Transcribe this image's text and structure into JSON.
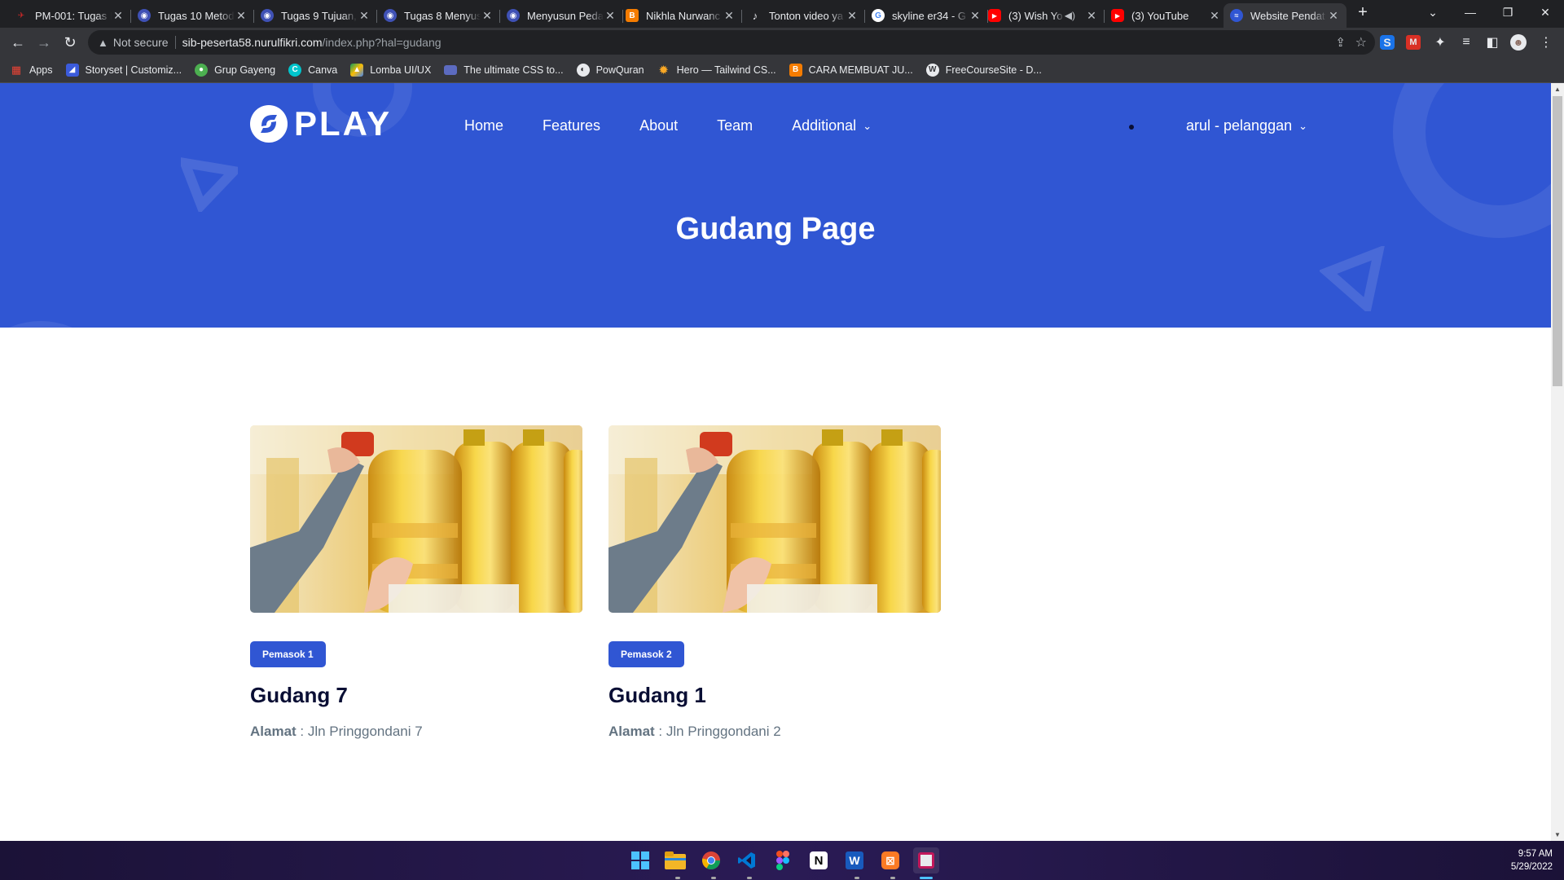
{
  "browser": {
    "tabs": [
      {
        "title": "PM-001: Tugas I",
        "favicon": "bird-icon",
        "color": "#c62828"
      },
      {
        "title": "Tugas 10 Metode",
        "favicon": "globe-icon",
        "color": "#3f51b5"
      },
      {
        "title": "Tugas 9 Tujuan,",
        "favicon": "globe-icon",
        "color": "#3f51b5"
      },
      {
        "title": "Tugas 8 Menyusu",
        "favicon": "globe-icon",
        "color": "#3f51b5"
      },
      {
        "title": "Menyusun Peda",
        "favicon": "globe-icon",
        "color": "#3f51b5"
      },
      {
        "title": "Nikhla Nurwanc",
        "favicon": "blogger-icon",
        "color": "#f57c00"
      },
      {
        "title": "Tonton video ya",
        "favicon": "tiktok-icon",
        "color": "#202124"
      },
      {
        "title": "skyline er34 - G",
        "favicon": "google-icon",
        "color": "#ffffff"
      },
      {
        "title": "(3) Wish Yo",
        "favicon": "youtube-icon",
        "color": "#ff0000"
      },
      {
        "title": "(3) YouTube",
        "favicon": "youtube-icon",
        "color": "#ff0000"
      },
      {
        "title": "Website Pendat",
        "favicon": "play-logo-icon",
        "color": "#3056d3"
      }
    ],
    "address": {
      "security": "Not secure",
      "host": "sib-peserta58.nurulfikri.com",
      "path": "/index.php?hal=gudang"
    },
    "bookmarks": [
      {
        "label": "Apps",
        "icon": "apps-grid-icon",
        "color": "#ea4335"
      },
      {
        "label": "Storyset | Customiz...",
        "icon": "storyset-icon",
        "color": "#3b5bdb"
      },
      {
        "label": "Grup Gayeng",
        "icon": "group-icon",
        "color": "#4caf50"
      },
      {
        "label": "Canva",
        "icon": "canva-icon",
        "color": "#00c4cc"
      },
      {
        "label": "Lomba UI/UX",
        "icon": "drive-icon",
        "color": "#fbbc04"
      },
      {
        "label": "The ultimate CSS to...",
        "icon": "page-icon",
        "color": "#5c6bc0"
      },
      {
        "label": "PowQuran",
        "icon": "quran-icon",
        "color": "#e8eaed"
      },
      {
        "label": "Hero — Tailwind CS...",
        "icon": "sun-icon",
        "color": "#f9a825"
      },
      {
        "label": "CARA MEMBUAT JU...",
        "icon": "blogger-icon",
        "color": "#f57c00"
      },
      {
        "label": "FreeCourseSite - D...",
        "icon": "wordpress-icon",
        "color": "#e8eaed"
      }
    ]
  },
  "site": {
    "logo": "PLAY",
    "nav": [
      "Home",
      "Features",
      "About",
      "Team",
      "Additional"
    ],
    "user": "arul - pelanggan",
    "hero_title": "Gudang Page",
    "accent": "#3056d3"
  },
  "cards": [
    {
      "badge": "Pemasok 1",
      "title": "Gudang 7",
      "addr_label": "Alamat",
      "addr_value": " : Jln Pringgondani 7"
    },
    {
      "badge": "Pemasok 2",
      "title": "Gudang 1",
      "addr_label": "Alamat",
      "addr_value": " : Jln Pringgondani 2"
    }
  ],
  "taskbar": {
    "apps": [
      "windows-start-icon",
      "file-explorer-icon",
      "chrome-icon",
      "vscode-icon",
      "figma-icon",
      "notion-icon",
      "word-icon",
      "xampp-icon",
      "snipping-tool-icon"
    ],
    "time": "9:57 AM",
    "date": "5/29/2022"
  }
}
